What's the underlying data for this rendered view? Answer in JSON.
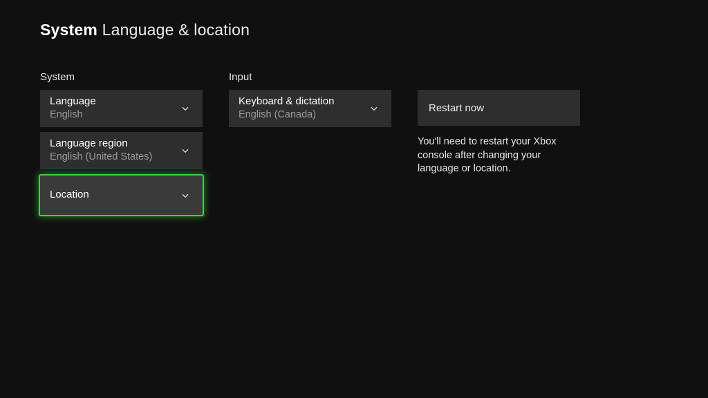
{
  "header": {
    "section": "System",
    "title": "Language & location"
  },
  "system": {
    "heading": "System",
    "language": {
      "label": "Language",
      "value": "English"
    },
    "region": {
      "label": "Language region",
      "value": "English (United States)"
    },
    "location": {
      "label": "Location",
      "value": ""
    }
  },
  "input": {
    "heading": "Input",
    "keyboard": {
      "label": "Keyboard & dictation",
      "value": "English (Canada)"
    }
  },
  "action": {
    "restart_label": "Restart now",
    "info": "You'll need to restart your Xbox console after changing your language or location."
  }
}
